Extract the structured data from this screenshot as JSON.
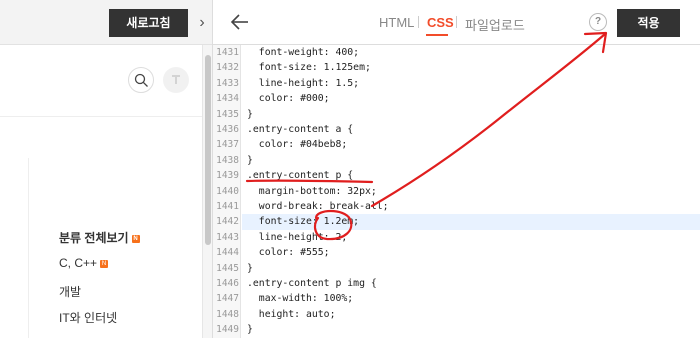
{
  "left": {
    "refresh_label": "새로고침",
    "collapse_icon": "›",
    "categories": [
      {
        "label": "분류 전체보기",
        "badge": "N",
        "bold": true
      },
      {
        "label": "C, C++",
        "badge": "N",
        "bold": false
      },
      {
        "label": "개발",
        "badge": "",
        "bold": false
      },
      {
        "label": "IT와 인터넷",
        "badge": "",
        "bold": false
      }
    ]
  },
  "header": {
    "tab_html": "HTML",
    "tab_css": "CSS",
    "tab_upload": "파일업로드",
    "help_label": "?",
    "apply_label": "적용"
  },
  "editor": {
    "lines": [
      {
        "n": "1431",
        "text": "  font-weight: 400;"
      },
      {
        "n": "1432",
        "text": "  font-size: 1.125em;"
      },
      {
        "n": "1433",
        "text": "  line-height: 1.5;"
      },
      {
        "n": "1434",
        "text": "  color: #000;"
      },
      {
        "n": "1435",
        "text": "}"
      },
      {
        "n": "1436",
        "text": ".entry-content a {"
      },
      {
        "n": "1437",
        "text": "  color: #04beb8;"
      },
      {
        "n": "1438",
        "text": "}"
      },
      {
        "n": "1439",
        "text": ".entry-content p {"
      },
      {
        "n": "1440",
        "text": "  margin-bottom: 32px;"
      },
      {
        "n": "1441",
        "text": "  word-break: break-all;"
      },
      {
        "n": "1442",
        "text": "  font-size: 1.2em;"
      },
      {
        "n": "1443",
        "text": "  line-height: 2;"
      },
      {
        "n": "1444",
        "text": "  color: #555;"
      },
      {
        "n": "1445",
        "text": "}"
      },
      {
        "n": "1446",
        "text": ".entry-content p img {"
      },
      {
        "n": "1447",
        "text": "  max-width: 100%;"
      },
      {
        "n": "1448",
        "text": "  height: auto;"
      },
      {
        "n": "1449",
        "text": "}"
      }
    ]
  },
  "colors": {
    "accent": "#f24c2a",
    "dark_button": "#333333",
    "annotation": "#e01e1e",
    "badge": "#f7711b"
  }
}
